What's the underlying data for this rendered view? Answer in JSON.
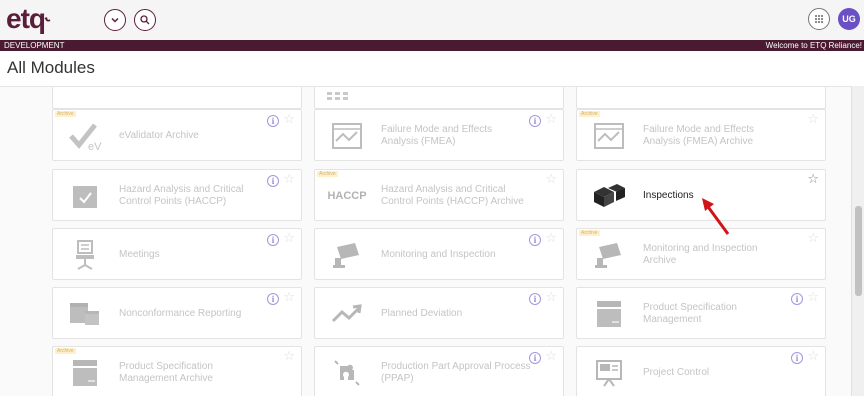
{
  "header": {
    "logo": "etq",
    "env_label": "DEVELOPMENT",
    "welcome": "Welcome to ETQ Reliance!",
    "avatar_initials": "UG"
  },
  "page_title": "All Modules",
  "colors": {
    "brand": "#5a1e3a",
    "env_bar": "#4a1a30",
    "info": "#6a55c8",
    "avatar": "#6b4fc4",
    "arrow": "#d0141a"
  },
  "modules": [
    {
      "label": "eValidator Archive",
      "archive_tag": "Archive",
      "icon": "evalidator-icon",
      "info": true
    },
    {
      "label": "Failure Mode and Effects Analysis (FMEA)",
      "archive_tag": "",
      "icon": "fmea-chart-icon",
      "info": true
    },
    {
      "label": "Failure Mode and Effects Analysis (FMEA) Archive",
      "archive_tag": "Archive",
      "icon": "fmea-chart-icon",
      "info": false
    },
    {
      "label": "Hazard Analysis and Critical Control Points (HACCP)",
      "archive_tag": "",
      "icon": "haccp-box-icon",
      "info": true
    },
    {
      "label": "Hazard Analysis and Critical Control Points (HACCP) Archive",
      "archive_tag": "Archive",
      "icon": "haccp-text-icon",
      "icon_text": "HACCP",
      "info": false
    },
    {
      "label": "Inspections",
      "archive_tag": "",
      "icon": "inspection-boxes-icon",
      "info": false
    },
    {
      "label": "Meetings",
      "archive_tag": "",
      "icon": "meeting-chair-icon",
      "info": true
    },
    {
      "label": "Monitoring and Inspection",
      "archive_tag": "",
      "icon": "camera-icon",
      "info": true
    },
    {
      "label": "Monitoring and Inspection Archive",
      "archive_tag": "Archive",
      "icon": "camera-icon",
      "info": false
    },
    {
      "label": "Nonconformance Reporting",
      "archive_tag": "",
      "icon": "nonconformance-boxes-icon",
      "info": true
    },
    {
      "label": "Planned Deviation",
      "archive_tag": "",
      "icon": "trend-arrow-icon",
      "info": true
    },
    {
      "label": "Product Specification Management",
      "archive_tag": "",
      "icon": "specification-box-icon",
      "info": true
    },
    {
      "label": "Product Specification Management Archive",
      "archive_tag": "Archive",
      "icon": "specification-box-icon",
      "info": false
    },
    {
      "label": "Production Part Approval Process (PPAP)",
      "archive_tag": "",
      "icon": "puzzle-icon",
      "info": true
    },
    {
      "label": "Project Control",
      "archive_tag": "",
      "icon": "project-board-icon",
      "info": true
    }
  ],
  "info_glyph": "i",
  "star_glyph": "☆"
}
